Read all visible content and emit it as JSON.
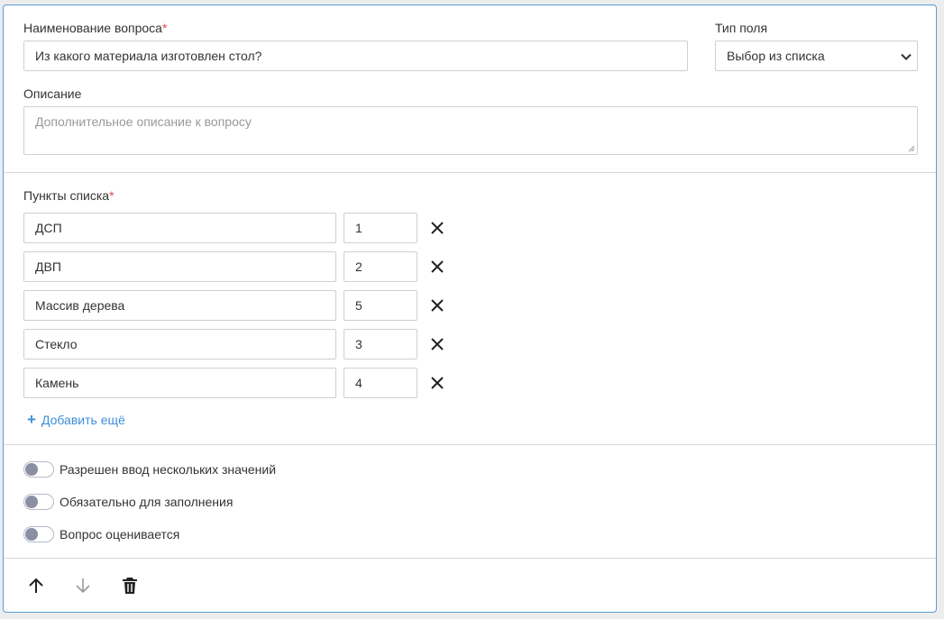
{
  "question": {
    "title_label": "Наименование вопроса",
    "required_mark": "*",
    "title_value": "Из какого материала изготовлен стол?",
    "field_type_label": "Тип поля",
    "field_type_value": "Выбор из списка",
    "description_label": "Описание",
    "description_placeholder": "Дополнительное описание к вопросу"
  },
  "list": {
    "label": "Пункты списка",
    "required_mark": "*",
    "items": [
      {
        "text": "ДСП",
        "value": "1"
      },
      {
        "text": "ДВП",
        "value": "2"
      },
      {
        "text": "Массив дерева",
        "value": "5"
      },
      {
        "text": "Стекло",
        "value": "3"
      },
      {
        "text": "Камень",
        "value": "4"
      }
    ],
    "add_more_label": "Добавить ещё"
  },
  "options": {
    "multiple_values": "Разрешен ввод нескольких значений",
    "required": "Обязательно для заполнения",
    "graded": "Вопрос оценивается"
  },
  "colors": {
    "accent": "#3d8fd8",
    "border": "#5b9bd8",
    "required": "#e0454b"
  }
}
